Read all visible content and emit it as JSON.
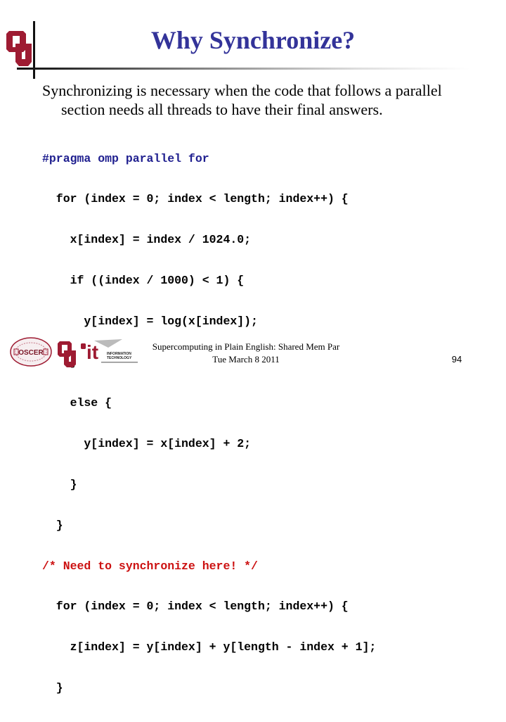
{
  "slide": {
    "title": "Why Synchronize?",
    "bullet": {
      "line1": "Synchronizing is necessary when the code that follows a parallel",
      "line2": "section needs all threads to have their final answers."
    },
    "code": [
      {
        "text": "#pragma omp parallel for",
        "style": "pragma"
      },
      {
        "text": "  for (index = 0; index < length; index++) {",
        "style": "normal"
      },
      {
        "text": "    x[index] = index / 1024.0;",
        "style": "normal"
      },
      {
        "text": "    if ((index / 1000) < 1) {",
        "style": "normal"
      },
      {
        "text": "      y[index] = log(x[index]);",
        "style": "normal"
      },
      {
        "text": "    }",
        "style": "normal"
      },
      {
        "text": "    else {",
        "style": "normal"
      },
      {
        "text": "      y[index] = x[index] + 2;",
        "style": "normal"
      },
      {
        "text": "    }",
        "style": "normal"
      },
      {
        "text": "  }",
        "style": "normal"
      },
      {
        "text": "/* Need to synchronize here! */",
        "style": "comment"
      },
      {
        "text": "  for (index = 0; index < length; index++) {",
        "style": "normal"
      },
      {
        "text": "    z[index] = y[index] + y[length - index + 1];",
        "style": "normal"
      },
      {
        "text": "  }",
        "style": "normal"
      }
    ],
    "footer": {
      "line1": "Supercomputing in Plain English: Shared Mem Par",
      "line2": "Tue March 8 2011"
    },
    "page_number": "94",
    "logos": {
      "header": "ou-logo",
      "footer": [
        "oscer-logo",
        "ou-logo",
        "ou-it-logo"
      ],
      "oscer_text": "OSCER",
      "it_text": "it",
      "it_caption_1": "INFORMATION",
      "it_caption_2": "TECHNOLOGY"
    },
    "colors": {
      "title": "#333399",
      "pragma": "#1f1f8f",
      "comment": "#cc1111",
      "ou_crimson": "#9e1b32"
    }
  }
}
